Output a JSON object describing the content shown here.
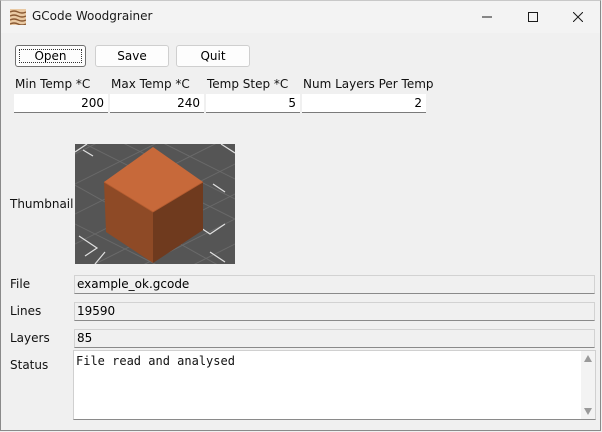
{
  "window": {
    "title": "GCode Woodgrainer",
    "icon": "woodgrain-icon",
    "controls": [
      "minimize-icon",
      "maximize-icon",
      "close-icon"
    ]
  },
  "toolbar": {
    "open_label": "Open",
    "save_label": "Save",
    "quit_label": "Quit"
  },
  "settings": {
    "min_temp": {
      "label": "Min Temp *C",
      "value": "200"
    },
    "max_temp": {
      "label": "Max Temp *C",
      "value": "240"
    },
    "temp_step": {
      "label": "Temp Step *C",
      "value": "5"
    },
    "layers_per_temp": {
      "label": "Num Layers Per Temp",
      "value": "2"
    }
  },
  "info": {
    "thumbnail_label": "Thumbnail",
    "thumbnail_image": "orange-cube-on-build-plate",
    "file_label": "File",
    "file_value": "example_ok.gcode",
    "lines_label": "Lines",
    "lines_value": "19590",
    "layers_label": "Layers",
    "layers_value": "85",
    "status_label": "Status",
    "status_value": "File read and analysed"
  },
  "colors": {
    "cube_top": "#c7693a",
    "cube_left": "#8e4a26",
    "cube_right": "#6f3a1e",
    "plate": "#555555"
  }
}
